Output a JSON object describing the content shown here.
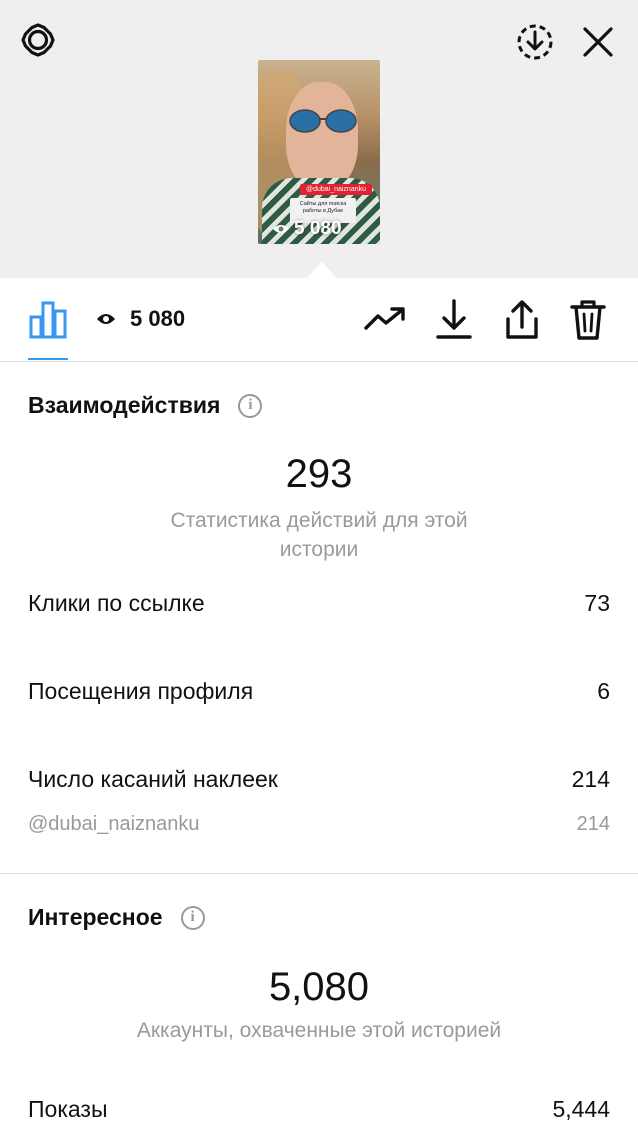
{
  "header": {
    "settings_icon": "gear-icon",
    "save_icon": "download-circle-icon",
    "close_icon": "close-icon"
  },
  "story": {
    "mention_tag": "@dubai_naiznanku",
    "card_text": "Сайты для поиска работы в Дубае",
    "views": "5 080"
  },
  "toolbar": {
    "views": "5 080",
    "icons": [
      "bar-chart-icon",
      "eye-icon",
      "trending-icon",
      "download-icon",
      "share-icon",
      "trash-icon"
    ]
  },
  "interactions": {
    "title": "Взаимодействия",
    "total": "293",
    "description": "Статистика действий для этой истории",
    "rows": [
      {
        "label": "Клики по ссылке",
        "value": "73"
      },
      {
        "label": "Посещения профиля",
        "value": "6"
      },
      {
        "label": "Число касаний наклеек",
        "value": "214"
      }
    ],
    "sticker": {
      "label": "@dubai_naiznanku",
      "value": "214"
    }
  },
  "discovery": {
    "title": "Интересное",
    "total": "5,080",
    "description": "Аккаунты, охваченные этой историей",
    "rows": [
      {
        "label": "Показы",
        "value": "5,444"
      }
    ]
  },
  "colors": {
    "accent": "#3897f0",
    "muted": "#9a9a9a",
    "divider": "#dbdbdb",
    "header_bg": "#efefef"
  }
}
